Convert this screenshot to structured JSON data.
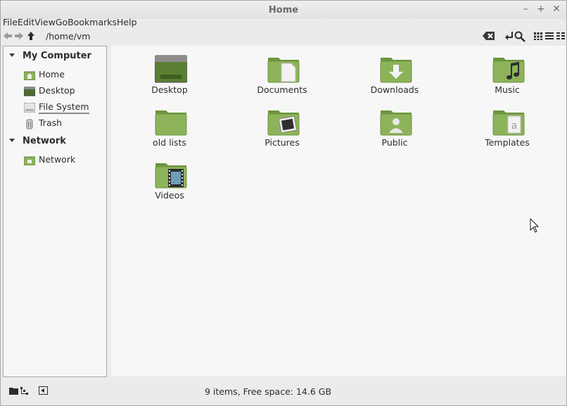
{
  "window": {
    "title": "Home"
  },
  "menu": [
    "File",
    "Edit",
    "View",
    "Go",
    "Bookmarks",
    "Help"
  ],
  "toolbar": {
    "path": "/home/vm"
  },
  "sidebar": {
    "sections": [
      {
        "label": "My Computer",
        "items": [
          {
            "label": "Home",
            "icon": "home-folder-icon"
          },
          {
            "label": "Desktop",
            "icon": "desktop-icon"
          },
          {
            "label": "File System",
            "icon": "drive-icon"
          },
          {
            "label": "Trash",
            "icon": "trash-icon"
          }
        ]
      },
      {
        "label": "Network",
        "items": [
          {
            "label": "Network",
            "icon": "network-icon"
          }
        ]
      }
    ]
  },
  "files": [
    {
      "name": "Desktop",
      "emblem": "desktop"
    },
    {
      "name": "Documents",
      "emblem": "document"
    },
    {
      "name": "Downloads",
      "emblem": "download"
    },
    {
      "name": "Music",
      "emblem": "music"
    },
    {
      "name": "old lists",
      "emblem": "none"
    },
    {
      "name": "Pictures",
      "emblem": "pictures"
    },
    {
      "name": "Public",
      "emblem": "public"
    },
    {
      "name": "Templates",
      "emblem": "templates"
    },
    {
      "name": "Videos",
      "emblem": "video"
    }
  ],
  "status": {
    "text": "9 items, Free space: 14.6 GB"
  },
  "colors": {
    "folder": "#8db35a",
    "folder_dark": "#6e9440",
    "accent": "#7aa54a"
  }
}
